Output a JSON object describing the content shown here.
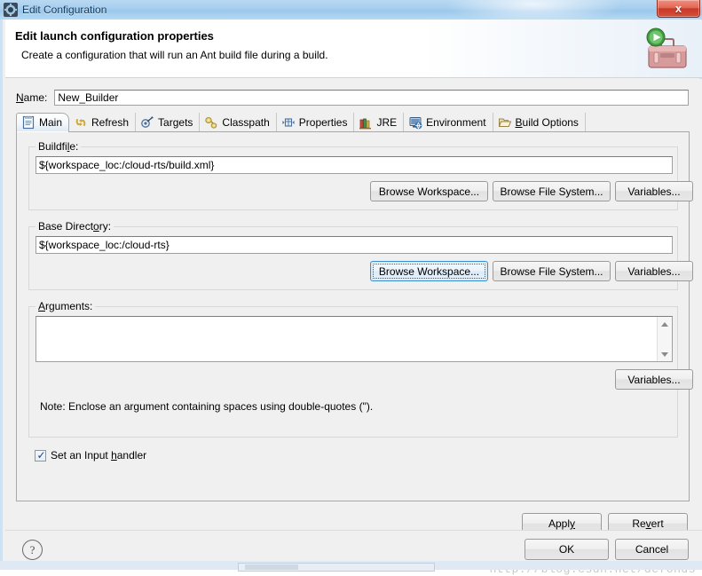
{
  "window": {
    "title": "Edit Configuration",
    "title_icon": "configuration-gear-icon",
    "close_label": "x"
  },
  "banner": {
    "title": "Edit launch configuration properties",
    "subtitle": "Create a configuration that will run an Ant build file during a build.",
    "icon": "ant-toolbox-run-icon"
  },
  "name_field": {
    "label": "Name:",
    "label_mnemonic": "N",
    "value": "New_Builder"
  },
  "tabs": [
    {
      "label": "Main",
      "icon": "main-document-icon",
      "selected": true
    },
    {
      "label": "Refresh",
      "icon": "refresh-arrows-icon",
      "selected": false
    },
    {
      "label": "Targets",
      "icon": "targets-icon",
      "selected": false
    },
    {
      "label": "Classpath",
      "icon": "classpath-icon",
      "selected": false
    },
    {
      "label": "Properties",
      "icon": "properties-icon",
      "selected": false
    },
    {
      "label": "JRE",
      "icon": "jre-books-icon",
      "selected": false
    },
    {
      "label": "Environment",
      "icon": "environment-icon",
      "selected": false
    },
    {
      "label": "Build Options",
      "icon": "build-options-folder-icon",
      "selected": false
    }
  ],
  "buildfile": {
    "group_label": "Buildfile:",
    "value": "${workspace_loc:/cloud-rts/build.xml}",
    "browse_workspace": "Browse Workspace...",
    "browse_filesystem": "Browse File System...",
    "variables": "Variables..."
  },
  "base_directory": {
    "group_label": "Base Directory:",
    "value": "${workspace_loc:/cloud-rts}",
    "browse_workspace": "Browse Workspace...",
    "browse_filesystem": "Browse File System...",
    "variables": "Variables...",
    "focused_button": "browse_workspace"
  },
  "arguments": {
    "group_label": "Arguments:",
    "value": "",
    "variables": "Variables...",
    "note": "Note: Enclose an argument containing spaces using double-quotes (\")."
  },
  "input_handler": {
    "label": "Set an Input handler",
    "checked": true,
    "check_glyph": "✓"
  },
  "actions": {
    "apply": "Apply",
    "revert": "Revert",
    "ok": "OK",
    "cancel": "Cancel",
    "help": "?"
  },
  "watermark": "http://blog.csdn.net/defonds",
  "colors": {
    "accent": "#3c8fd0",
    "titlebar": "#a8cfef",
    "close_button": "#c8392a",
    "dialog_bg": "#f0f0f0"
  }
}
